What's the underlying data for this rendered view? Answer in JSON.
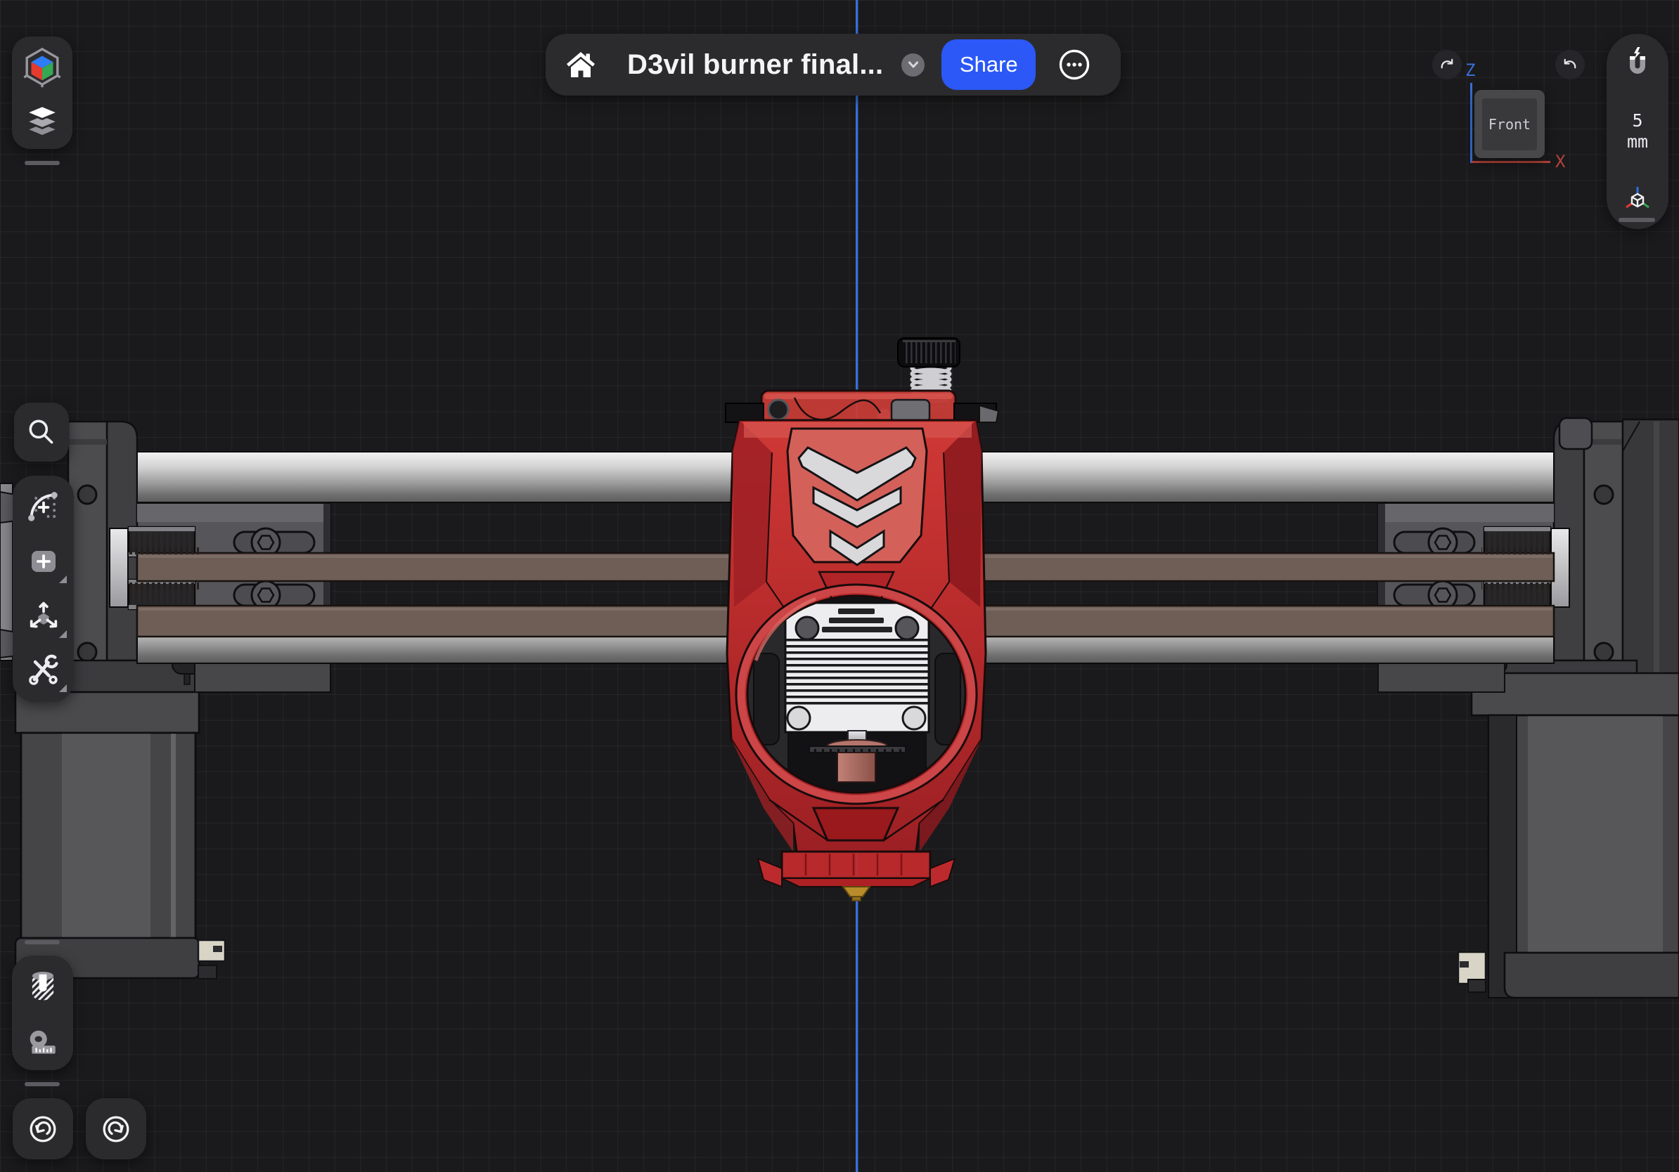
{
  "colors": {
    "background": "#1a1a1c",
    "grid_line": "rgba(255,255,255,0.05)",
    "panel": "#2b2b2e",
    "accent_blue": "#2b58f6",
    "title_text": "#f4f4f6",
    "z_axis_blue": "#3a6fd8",
    "x_axis_red": "#b5423a",
    "model_red": "#b62a2b",
    "belt_brown": "#6e5e56",
    "rail_silver": "#c9c9c9",
    "heatsink_white": "#ededef",
    "nozzle_brass": "#b98c2b"
  },
  "header": {
    "title": "D3vil burner final...",
    "share_label": "Share"
  },
  "view_gizmo": {
    "cube_face_label": "Front",
    "vertical_axis_label": "Z",
    "horizontal_axis_label": "X"
  },
  "snap_panel": {
    "value": "5",
    "unit": "mm"
  },
  "toolbars": {
    "top_left_icons": [
      "orientation-cube-icon",
      "layers-icon"
    ],
    "left_icons": [
      "search-icon",
      "sketch-arc-icon",
      "add-body-icon",
      "move-transform-icon",
      "tools-icon"
    ],
    "bottom_left_icons": [
      "section-view-icon",
      "measure-tape-icon",
      "undo-icon",
      "redo-icon"
    ],
    "top_right_icons": [
      "rotate-view-cw-icon",
      "rotate-view-ccw-icon",
      "snap-magnet-icon",
      "axis-orientation-icon"
    ]
  }
}
